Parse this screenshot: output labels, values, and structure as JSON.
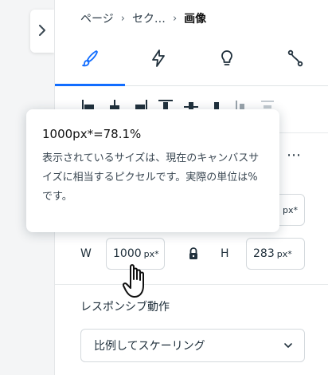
{
  "breadcrumb": {
    "items": [
      "ページ",
      "セク…",
      "画像"
    ],
    "separator": "›"
  },
  "tabs": [
    {
      "icon": "brush-icon",
      "active": true
    },
    {
      "icon": "lightning-icon",
      "active": false
    },
    {
      "icon": "lightbulb-icon",
      "active": false
    },
    {
      "icon": "connector-icon",
      "active": false
    }
  ],
  "alignment_tools": [
    "align-left-icon",
    "align-center-h-icon",
    "align-right-icon",
    "align-top-icon",
    "align-middle-v-icon",
    "align-bottom-icon",
    "distribute-icon",
    "distribute-disabled-icon"
  ],
  "more_label": "⋯",
  "top_unit": "px*",
  "size": {
    "w_label": "W",
    "w_value": "1000",
    "w_unit": "px*",
    "h_label": "H",
    "h_value": "283",
    "h_unit": "px*"
  },
  "responsive": {
    "label": "レスポンシブ動作",
    "selected": "比例してスケーリング"
  },
  "tooltip": {
    "title": "1000px*=78.1%",
    "body": "表示されているサイズは、現在のキャンバスサイズに相当するピクセルです。実際の単位は%です。"
  },
  "colors": {
    "accent": "#116dff",
    "text": "#20303c",
    "border": "#d4d9dd"
  }
}
